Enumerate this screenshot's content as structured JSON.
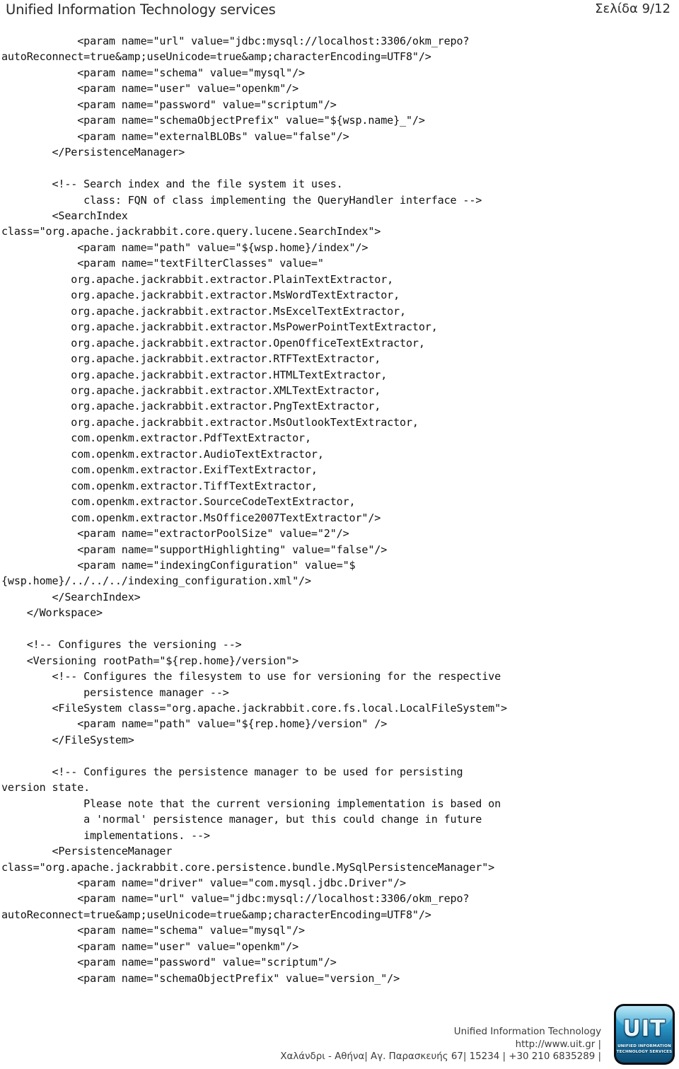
{
  "header": {
    "title": "Unified Information Technology services",
    "page_label": "Σελίδα 9/12"
  },
  "document": {
    "code": "            <param name=\"url\" value=\"jdbc:mysql://localhost:3306/okm_repo?\nautoReconnect=true&amp;useUnicode=true&amp;characterEncoding=UTF8\"/>\n            <param name=\"schema\" value=\"mysql\"/>\n            <param name=\"user\" value=\"openkm\"/>\n            <param name=\"password\" value=\"scriptum\"/>\n            <param name=\"schemaObjectPrefix\" value=\"${wsp.name}_\"/>\n            <param name=\"externalBLOBs\" value=\"false\"/>\n        </PersistenceManager>\n\n        <!-- Search index and the file system it uses.\n             class: FQN of class implementing the QueryHandler interface -->\n        <SearchIndex\nclass=\"org.apache.jackrabbit.core.query.lucene.SearchIndex\">\n            <param name=\"path\" value=\"${wsp.home}/index\"/>\n            <param name=\"textFilterClasses\" value=\"\n           org.apache.jackrabbit.extractor.PlainTextExtractor,\n           org.apache.jackrabbit.extractor.MsWordTextExtractor,\n           org.apache.jackrabbit.extractor.MsExcelTextExtractor,\n           org.apache.jackrabbit.extractor.MsPowerPointTextExtractor,\n           org.apache.jackrabbit.extractor.OpenOfficeTextExtractor,\n           org.apache.jackrabbit.extractor.RTFTextExtractor,\n           org.apache.jackrabbit.extractor.HTMLTextExtractor,\n           org.apache.jackrabbit.extractor.XMLTextExtractor,\n           org.apache.jackrabbit.extractor.PngTextExtractor,\n           org.apache.jackrabbit.extractor.MsOutlookTextExtractor,\n           com.openkm.extractor.PdfTextExtractor,\n           com.openkm.extractor.AudioTextExtractor,\n           com.openkm.extractor.ExifTextExtractor,\n           com.openkm.extractor.TiffTextExtractor,\n           com.openkm.extractor.SourceCodeTextExtractor,\n           com.openkm.extractor.MsOffice2007TextExtractor\"/>\n            <param name=\"extractorPoolSize\" value=\"2\"/>\n            <param name=\"supportHighlighting\" value=\"false\"/>\n            <param name=\"indexingConfiguration\" value=\"$\n{wsp.home}/../../../indexing_configuration.xml\"/>\n        </SearchIndex>\n    </Workspace>\n\n    <!-- Configures the versioning -->\n    <Versioning rootPath=\"${rep.home}/version\">\n        <!-- Configures the filesystem to use for versioning for the respective\n             persistence manager -->\n        <FileSystem class=\"org.apache.jackrabbit.core.fs.local.LocalFileSystem\">\n            <param name=\"path\" value=\"${rep.home}/version\" />\n        </FileSystem>\n\n        <!-- Configures the persistence manager to be used for persisting\nversion state.\n             Please note that the current versioning implementation is based on\n             a 'normal' persistence manager, but this could change in future\n             implementations. -->\n        <PersistenceManager\nclass=\"org.apache.jackrabbit.core.persistence.bundle.MySqlPersistenceManager\">\n            <param name=\"driver\" value=\"com.mysql.jdbc.Driver\"/>\n            <param name=\"url\" value=\"jdbc:mysql://localhost:3306/okm_repo?\nautoReconnect=true&amp;useUnicode=true&amp;characterEncoding=UTF8\"/>\n            <param name=\"schema\" value=\"mysql\"/>\n            <param name=\"user\" value=\"openkm\"/>\n            <param name=\"password\" value=\"scriptum\"/>\n            <param name=\"schemaObjectPrefix\" value=\"version_\"/>"
  },
  "footer": {
    "company": "Unified Information Technology",
    "website": "http://www.uit.gr |",
    "address": "Χαλάνδρι - Αθήνα| Αγ. Παρασκευής 67| 15234 | +30 210 6835289 |",
    "logo": {
      "mark": "UIT",
      "tagline_line1": "UNIFIED INFORMATION",
      "tagline_line2": "TECHNOLOGY SERVICES",
      "accent_color": "#2e9fd0"
    }
  }
}
